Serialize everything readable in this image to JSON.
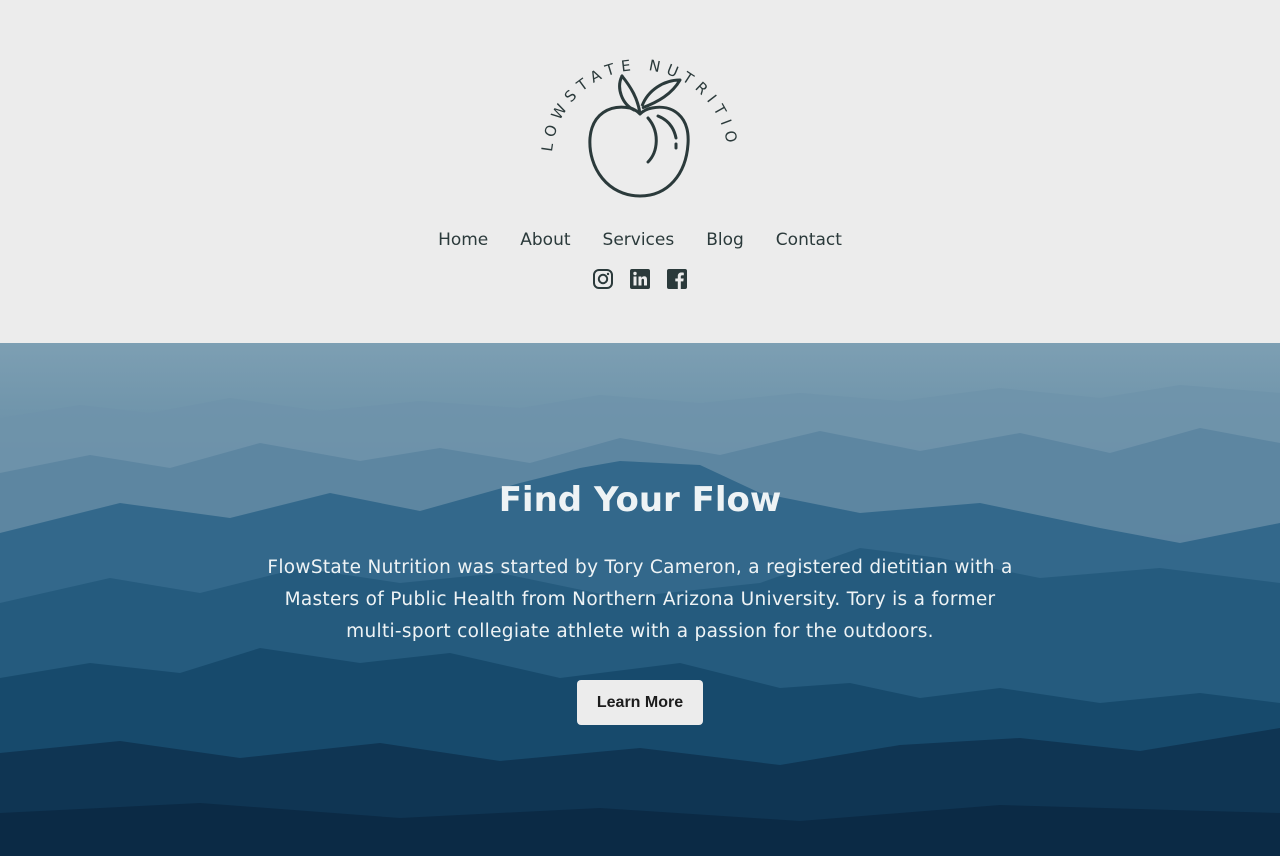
{
  "brand": {
    "name": "FLOWSTATE NUTRITION"
  },
  "nav": {
    "items": [
      {
        "label": "Home"
      },
      {
        "label": "About"
      },
      {
        "label": "Services"
      },
      {
        "label": "Blog"
      },
      {
        "label": "Contact"
      }
    ]
  },
  "social": {
    "icons": [
      "instagram-icon",
      "linkedin-icon",
      "facebook-icon"
    ]
  },
  "hero": {
    "title": "Find Your Flow",
    "text": "FlowState Nutrition was started by Tory Cameron, a registered dietitian with a Masters of Public Health from Northern Arizona University. Tory is a former multi-sport collegiate athlete with a passion for the outdoors.",
    "button_label": "Learn More"
  },
  "colors": {
    "header_bg": "#ececec",
    "text_dark": "#2b3a3b",
    "hero_light": "#ffffff"
  }
}
